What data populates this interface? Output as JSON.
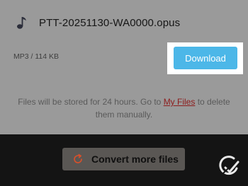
{
  "file": {
    "icon": "music-note-icon",
    "name": "PTT-20251130-WA0000.opus",
    "meta": "MP3 / 114 KB"
  },
  "download": {
    "label": "Download",
    "color": "#4cb7e8"
  },
  "info": {
    "text_before": "Files will be stored for 24 hours. Go to ",
    "link_label": "My Files",
    "text_after": " to delete them manually."
  },
  "footer": {
    "convert_label": "Convert more files",
    "convert_icon": "refresh-icon",
    "logo_icon": "brand-logo-icon"
  }
}
